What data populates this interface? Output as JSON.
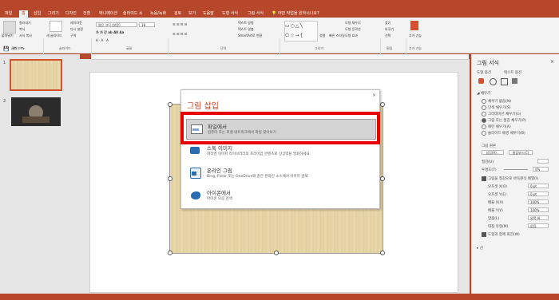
{
  "tabs": [
    {
      "label": "파일"
    },
    {
      "label": "홈"
    },
    {
      "label": "삽입"
    },
    {
      "label": "그리기"
    },
    {
      "label": "디자인"
    },
    {
      "label": "전환"
    },
    {
      "label": "애니메이션"
    },
    {
      "label": "슬라이드 쇼"
    },
    {
      "label": "녹음/녹화"
    },
    {
      "label": "검토"
    },
    {
      "label": "보기"
    },
    {
      "label": "도움말"
    },
    {
      "label": "도형 서식"
    },
    {
      "label": "그림 서식"
    }
  ],
  "tell_me": "어떤 작업을 원하시나요?",
  "ribbon": {
    "paste": "붙여넣기",
    "cut": "잘라내기",
    "copy": "복사",
    "format_painter": "서식 복사",
    "new_slide": "새 슬라이드",
    "layout": "레이아웃",
    "reset": "다시 설정",
    "section": "구역",
    "font_name": "맑은 고딕 (본문)",
    "font_size": "18",
    "text_direction": "텍스트 방향",
    "align_text": "텍스트 맞춤",
    "smartart": "SmartArt로 변환",
    "arrange": "정렬",
    "quick_styles": "빠른 스타일",
    "shape_fill": "도형 채우기",
    "shape_outline": "도형 윤곽선",
    "shape_effects": "도형 효과",
    "find": "찾기",
    "replace": "바꾸기",
    "select": "선택",
    "add_in": "추가 기능",
    "groups": {
      "clipboard": "클립보드",
      "slides": "슬라이드",
      "font": "글꼴",
      "paragraph": "단락",
      "drawing": "그리기",
      "editing": "편집",
      "addins": "추가 기능"
    }
  },
  "slides": [
    {
      "number": "1"
    },
    {
      "number": "2"
    }
  ],
  "dialog": {
    "title": "그림 삽입",
    "close": "×",
    "options": [
      {
        "title": "파일에서",
        "desc": "컴퓨터 또는 로컬 네트워크에서 파일 찾아보기"
      },
      {
        "title": "스톡 이미지",
        "desc": "저작권 이미지 라이브러리의 프리미엄 콘텐츠로 상상력을 발휘하세요."
      },
      {
        "title": "온라인 그림",
        "desc": "Bing, Flickr 또는 OneDrive와 같은 온라인 소스에서 이미지 검색"
      },
      {
        "title": "아이콘에서",
        "desc": "아이콘 모음 검색"
      }
    ]
  },
  "pane": {
    "title": "그림 서식",
    "subtabs": [
      "도형 옵션",
      "텍스트 옵션"
    ],
    "section": "채우기",
    "fill_options": [
      "채우기 없음(N)",
      "단색 채우기(S)",
      "그라데이션 채우기(G)",
      "그림 또는 질감 채우기(P)",
      "패턴 채우기(A)",
      "슬라이드 배경 채우기(B)"
    ],
    "fill_selected_index": 3,
    "picture_source": "그림 원본",
    "insert_btn": "삽입(R)...",
    "clipboard_btn": "클립보드(C)",
    "texture": "질감(U)",
    "transparency": "투명도(T)",
    "transparency_value": "0%",
    "tile_check": "그림을 질감으로 바둑판식 배열(I)",
    "offset_x": "오프셋 X(O)",
    "offset_x_val": "0 pt",
    "offset_y": "오프셋 Y(E)",
    "offset_y_val": "0 pt",
    "scale_x": "배율 X(X)",
    "scale_x_val": "100%",
    "scale_y": "배율 Y(Y)",
    "scale_y_val": "100%",
    "alignment": "맞춤(L)",
    "alignment_val": "왼쪽 위",
    "mirror": "대칭 유형(M)",
    "mirror_val": "없음",
    "rotate_check": "도형과 함께 회전(W)",
    "line_section": "선"
  },
  "colors": {
    "accent": "#b7472a",
    "highlight": "#e60000"
  }
}
